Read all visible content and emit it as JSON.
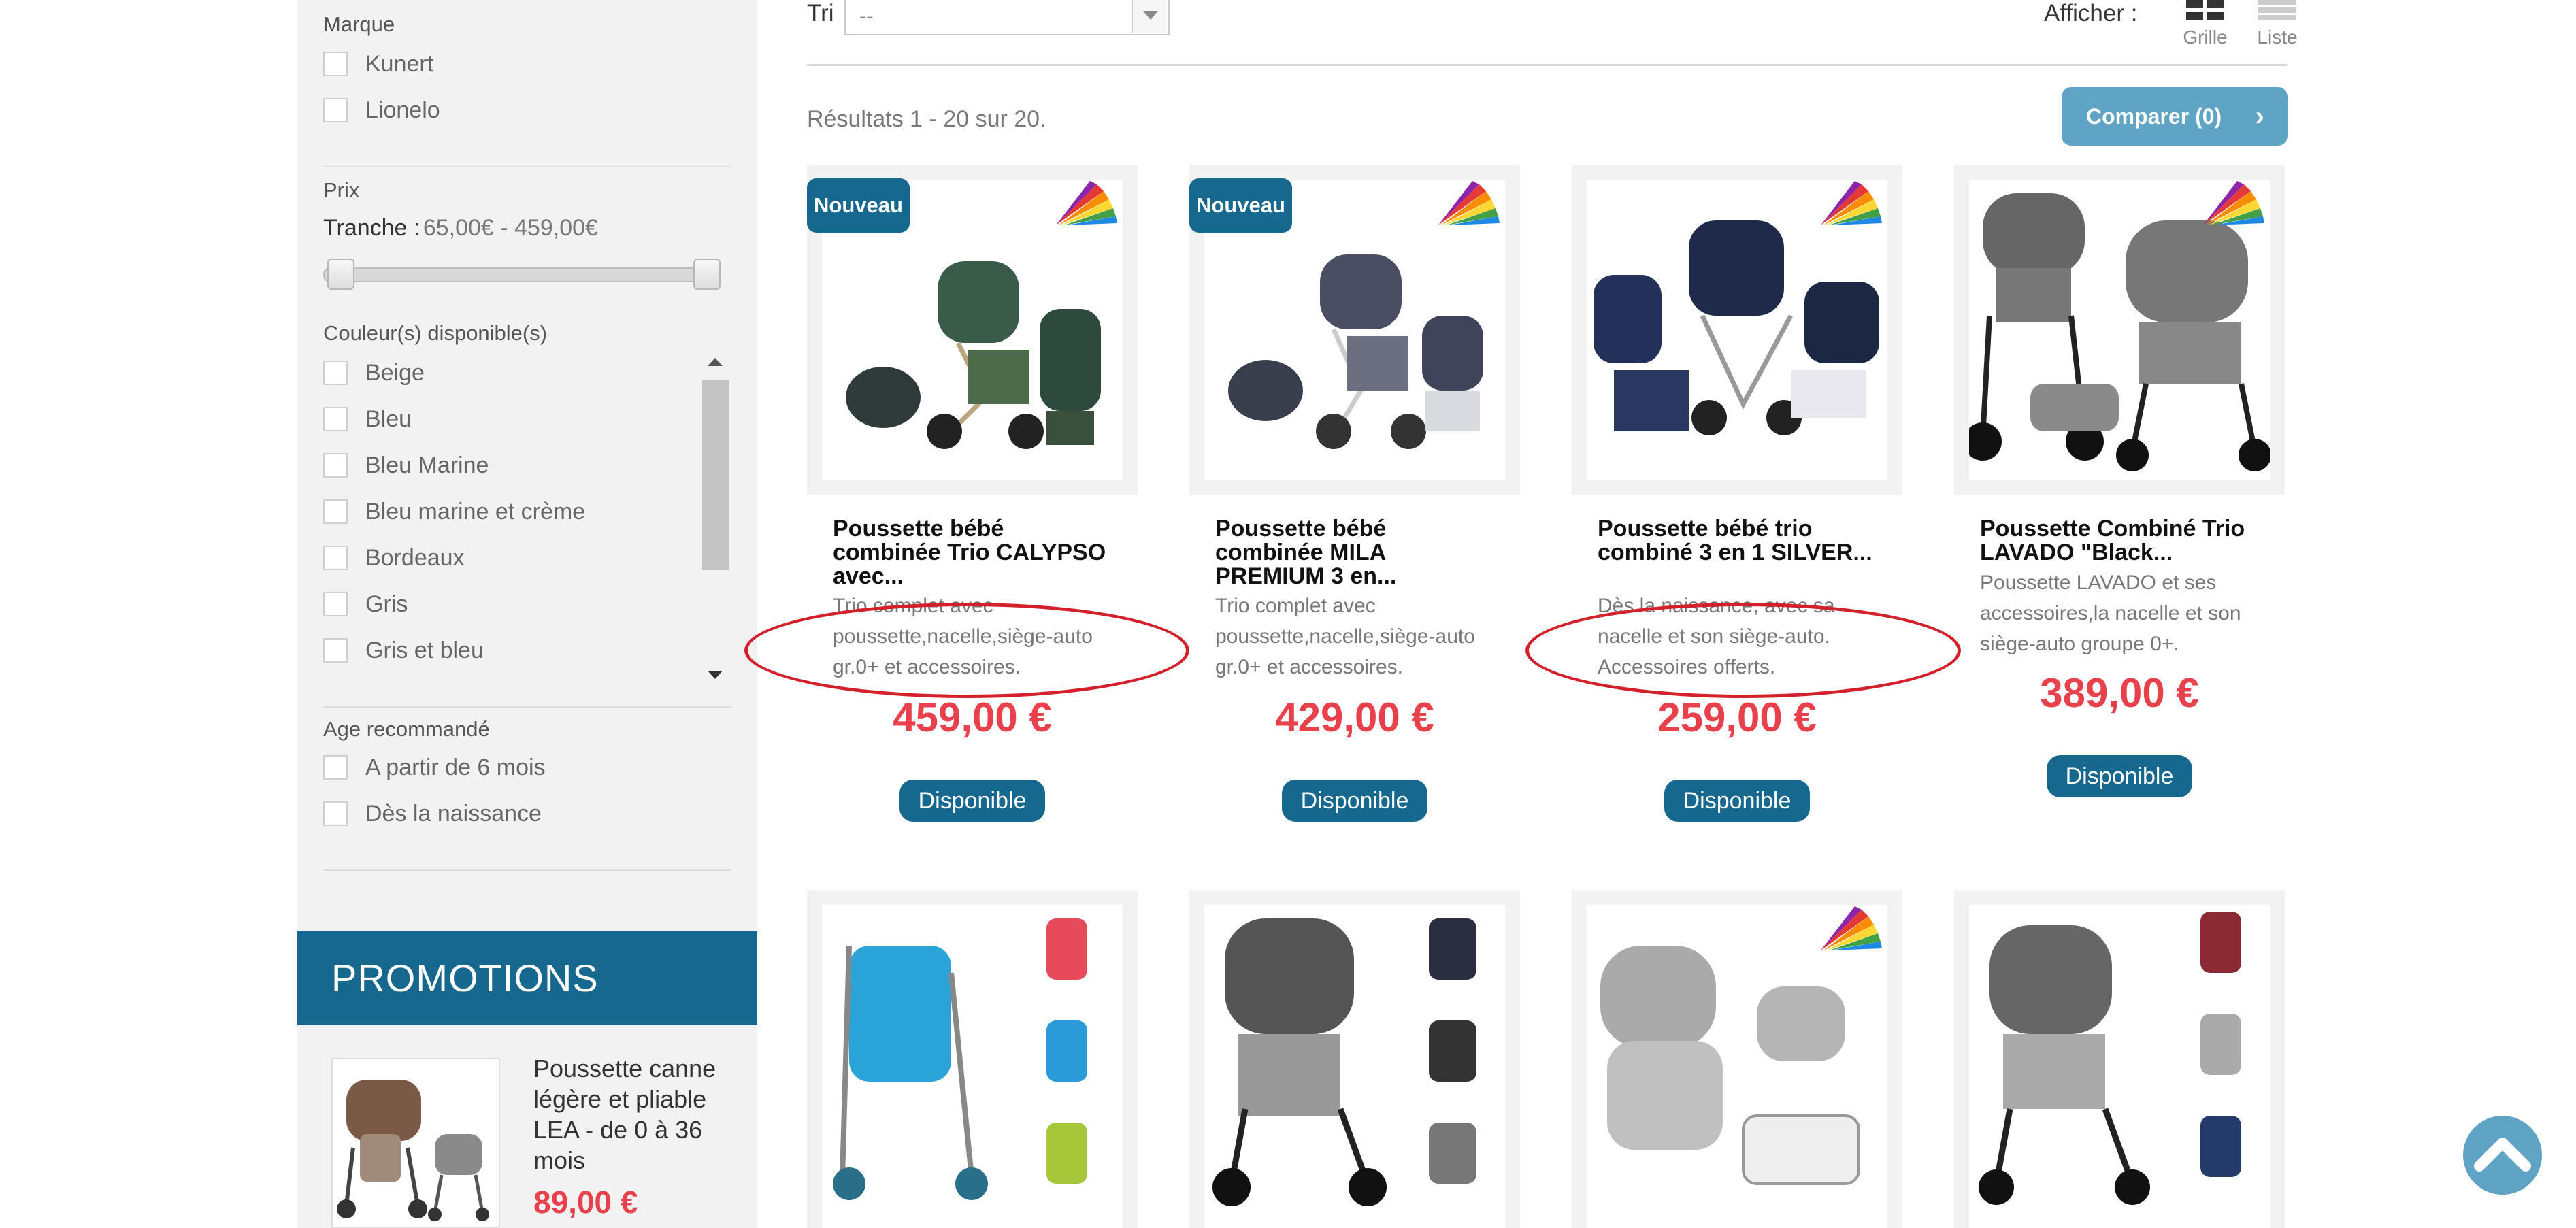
{
  "sidebar": {
    "marque": {
      "title": "Marque",
      "options": [
        "Kunert",
        "Lionelo"
      ]
    },
    "prix": {
      "title": "Prix",
      "range_label": "Tranche :",
      "range_value": "65,00€ - 459,00€"
    },
    "couleurs": {
      "title": "Couleur(s) disponible(s)",
      "options": [
        "Beige",
        "Bleu",
        "Bleu Marine",
        "Bleu marine et crème",
        "Bordeaux",
        "Gris",
        "Gris et bleu"
      ]
    },
    "age": {
      "title": "Age recommandé",
      "options": [
        "A partir de 6 mois",
        "Dès la naissance"
      ]
    },
    "promotions": {
      "title": "PROMOTIONS",
      "item": {
        "name": "Poussette canne légère et pliable LEA - de 0 à 36 mois",
        "price": "89,00 €"
      }
    }
  },
  "toolbar": {
    "sort_label": "Tri",
    "sort_value": "--",
    "view_label": "Afficher :",
    "grid_label": "Grille",
    "list_label": "Liste",
    "results": "Résultats 1 - 20 sur 20.",
    "compare_label": "Comparer (0)"
  },
  "products": [
    {
      "badge": "Nouveau",
      "name": "Poussette bébé combinée Trio CALYPSO avec...",
      "desc": "Trio complet avec poussette,nacelle,siège-auto gr.0+ et accessoires.",
      "price": "459,00 €",
      "status": "Disponible"
    },
    {
      "badge": "Nouveau",
      "name": "Poussette bébé combinée MILA PREMIUM 3 en...",
      "desc": "Trio complet avec poussette,nacelle,siège-auto gr.0+ et accessoires.",
      "price": "429,00 €",
      "status": "Disponible"
    },
    {
      "badge": "",
      "name": "Poussette bébé trio combiné 3 en 1 SILVER...",
      "desc": "Dès la naissance, avec sa nacelle et son siège-auto. Accessoires offerts.",
      "price": "259,00 €",
      "status": "Disponible"
    },
    {
      "badge": "",
      "name": "Poussette Combiné Trio LAVADO \"Black...",
      "desc": "Poussette LAVADO et ses accessoires,la nacelle et son siège-auto groupe 0+.",
      "price": "389,00 €",
      "status": "Disponible"
    }
  ],
  "colors": {
    "brand": "#17688f",
    "accent": "#5fa3c5",
    "price": "#e8414c",
    "annotation": "#d3202b"
  }
}
